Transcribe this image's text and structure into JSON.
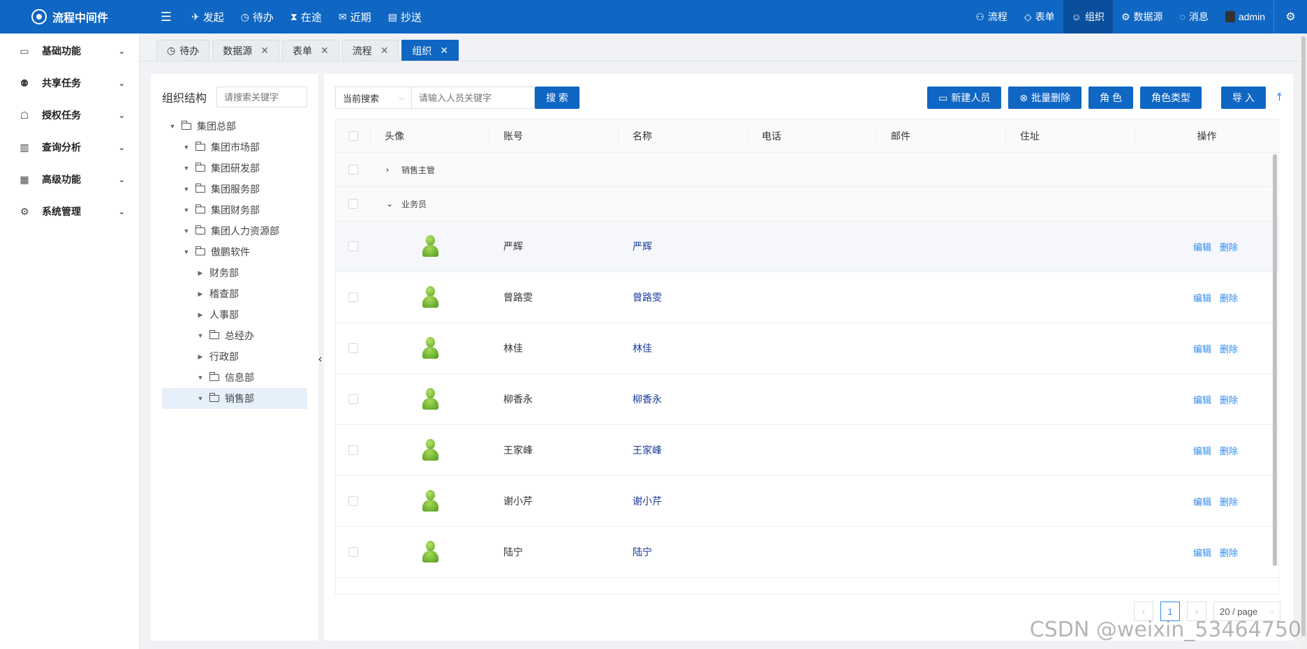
{
  "app": {
    "name": "流程中间件"
  },
  "topnav": {
    "left": [
      {
        "icon": "send-icon",
        "glyph": "✈",
        "label": "发起"
      },
      {
        "icon": "clock-icon",
        "glyph": "◷",
        "label": "待办"
      },
      {
        "icon": "hourglass-icon",
        "glyph": "⧗",
        "label": "在途"
      },
      {
        "icon": "mail-icon",
        "glyph": "✉",
        "label": "近期"
      },
      {
        "icon": "clipboard-icon",
        "glyph": "▤",
        "label": "抄送"
      }
    ],
    "right": [
      {
        "icon": "flow-icon",
        "glyph": "⚇",
        "label": "流程"
      },
      {
        "icon": "diamond-icon",
        "glyph": "◇",
        "label": "表单"
      },
      {
        "icon": "user-icon",
        "glyph": "☺",
        "label": "组织",
        "active": true
      },
      {
        "icon": "gear-icon",
        "glyph": "⚙",
        "label": "数据源"
      },
      {
        "icon": "chat-icon",
        "glyph": "◌",
        "label": "消息"
      },
      {
        "icon": "avatar-icon",
        "glyph": "",
        "label": "admin"
      }
    ]
  },
  "sidebar": {
    "items": [
      {
        "icon": "folder-icon",
        "glyph": "▭",
        "label": "基础功能"
      },
      {
        "icon": "users-icon",
        "glyph": "⚉",
        "label": "共享任务"
      },
      {
        "icon": "key-user-icon",
        "glyph": "☖",
        "label": "授权任务"
      },
      {
        "icon": "bar-chart-icon",
        "glyph": "▥",
        "label": "查询分析"
      },
      {
        "icon": "grid-icon",
        "glyph": "▦",
        "label": "高级功能"
      },
      {
        "icon": "settings-icon",
        "glyph": "⚙",
        "label": "系统管理"
      }
    ]
  },
  "tabs": [
    {
      "label": "待办",
      "closable": false,
      "icon": true
    },
    {
      "label": "数据源",
      "closable": true
    },
    {
      "label": "表单",
      "closable": true
    },
    {
      "label": "流程",
      "closable": true
    },
    {
      "label": "组织",
      "closable": true,
      "active": true
    }
  ],
  "org": {
    "title": "组织结构",
    "search_placeholder": "请搜索关键字",
    "tree": [
      {
        "label": "集团总部",
        "level": 0,
        "expanded": true,
        "folder": true
      },
      {
        "label": "集团市场部",
        "level": 1,
        "expanded": true,
        "folder": true
      },
      {
        "label": "集团研发部",
        "level": 1,
        "expanded": true,
        "folder": true
      },
      {
        "label": "集团服务部",
        "level": 1,
        "expanded": true,
        "folder": true
      },
      {
        "label": "集团财务部",
        "level": 1,
        "expanded": true,
        "folder": true
      },
      {
        "label": "集团人力资源部",
        "level": 1,
        "expanded": true,
        "folder": true
      },
      {
        "label": "傲鹏软件",
        "level": 1,
        "expanded": true,
        "folder": true
      },
      {
        "label": "财务部",
        "level": 2,
        "expanded": false,
        "folder": false
      },
      {
        "label": "稽查部",
        "level": 2,
        "expanded": false,
        "folder": false
      },
      {
        "label": "人事部",
        "level": 2,
        "expanded": false,
        "folder": false
      },
      {
        "label": "总经办",
        "level": 2,
        "expanded": true,
        "folder": true
      },
      {
        "label": "行政部",
        "level": 2,
        "expanded": false,
        "folder": false
      },
      {
        "label": "信息部",
        "level": 2,
        "expanded": true,
        "folder": true
      },
      {
        "label": "销售部",
        "level": 2,
        "expanded": true,
        "folder": true,
        "selected": true
      }
    ]
  },
  "toolbar": {
    "scope": "当前搜索",
    "keyword_placeholder": "请输入人员关键字",
    "search_label": "搜 索",
    "new_label": "新建人员",
    "batch_delete_label": "批量删除",
    "role_label": "角 色",
    "role_type_label": "角色类型",
    "import_label": "导 入"
  },
  "table": {
    "columns": [
      "头像",
      "账号",
      "名称",
      "电话",
      "邮件",
      "住址",
      "操作"
    ],
    "groups": [
      {
        "label": "销售主管",
        "expanded": false
      },
      {
        "label": "业务员",
        "expanded": true
      }
    ],
    "rows": [
      {
        "account": "严辉",
        "name": "严辉",
        "phone": "",
        "mail": "",
        "addr": ""
      },
      {
        "account": "曾路雯",
        "name": "曾路雯",
        "phone": "",
        "mail": "",
        "addr": ""
      },
      {
        "account": "林佳",
        "name": "林佳",
        "phone": "",
        "mail": "",
        "addr": ""
      },
      {
        "account": "柳香永",
        "name": "柳香永",
        "phone": "",
        "mail": "",
        "addr": ""
      },
      {
        "account": "王家峰",
        "name": "王家峰",
        "phone": "",
        "mail": "",
        "addr": ""
      },
      {
        "account": "谢小芹",
        "name": "谢小芹",
        "phone": "",
        "mail": "",
        "addr": ""
      },
      {
        "account": "陆宁",
        "name": "陆宁",
        "phone": "",
        "mail": "",
        "addr": ""
      }
    ],
    "edit_label": "编辑",
    "delete_label": "删除"
  },
  "pager": {
    "page": "1",
    "size": "20 / page"
  },
  "watermark": "CSDN @weixin_53464750",
  "colors": {
    "primary": "#0f66c3",
    "link": "#2d8cf0"
  }
}
